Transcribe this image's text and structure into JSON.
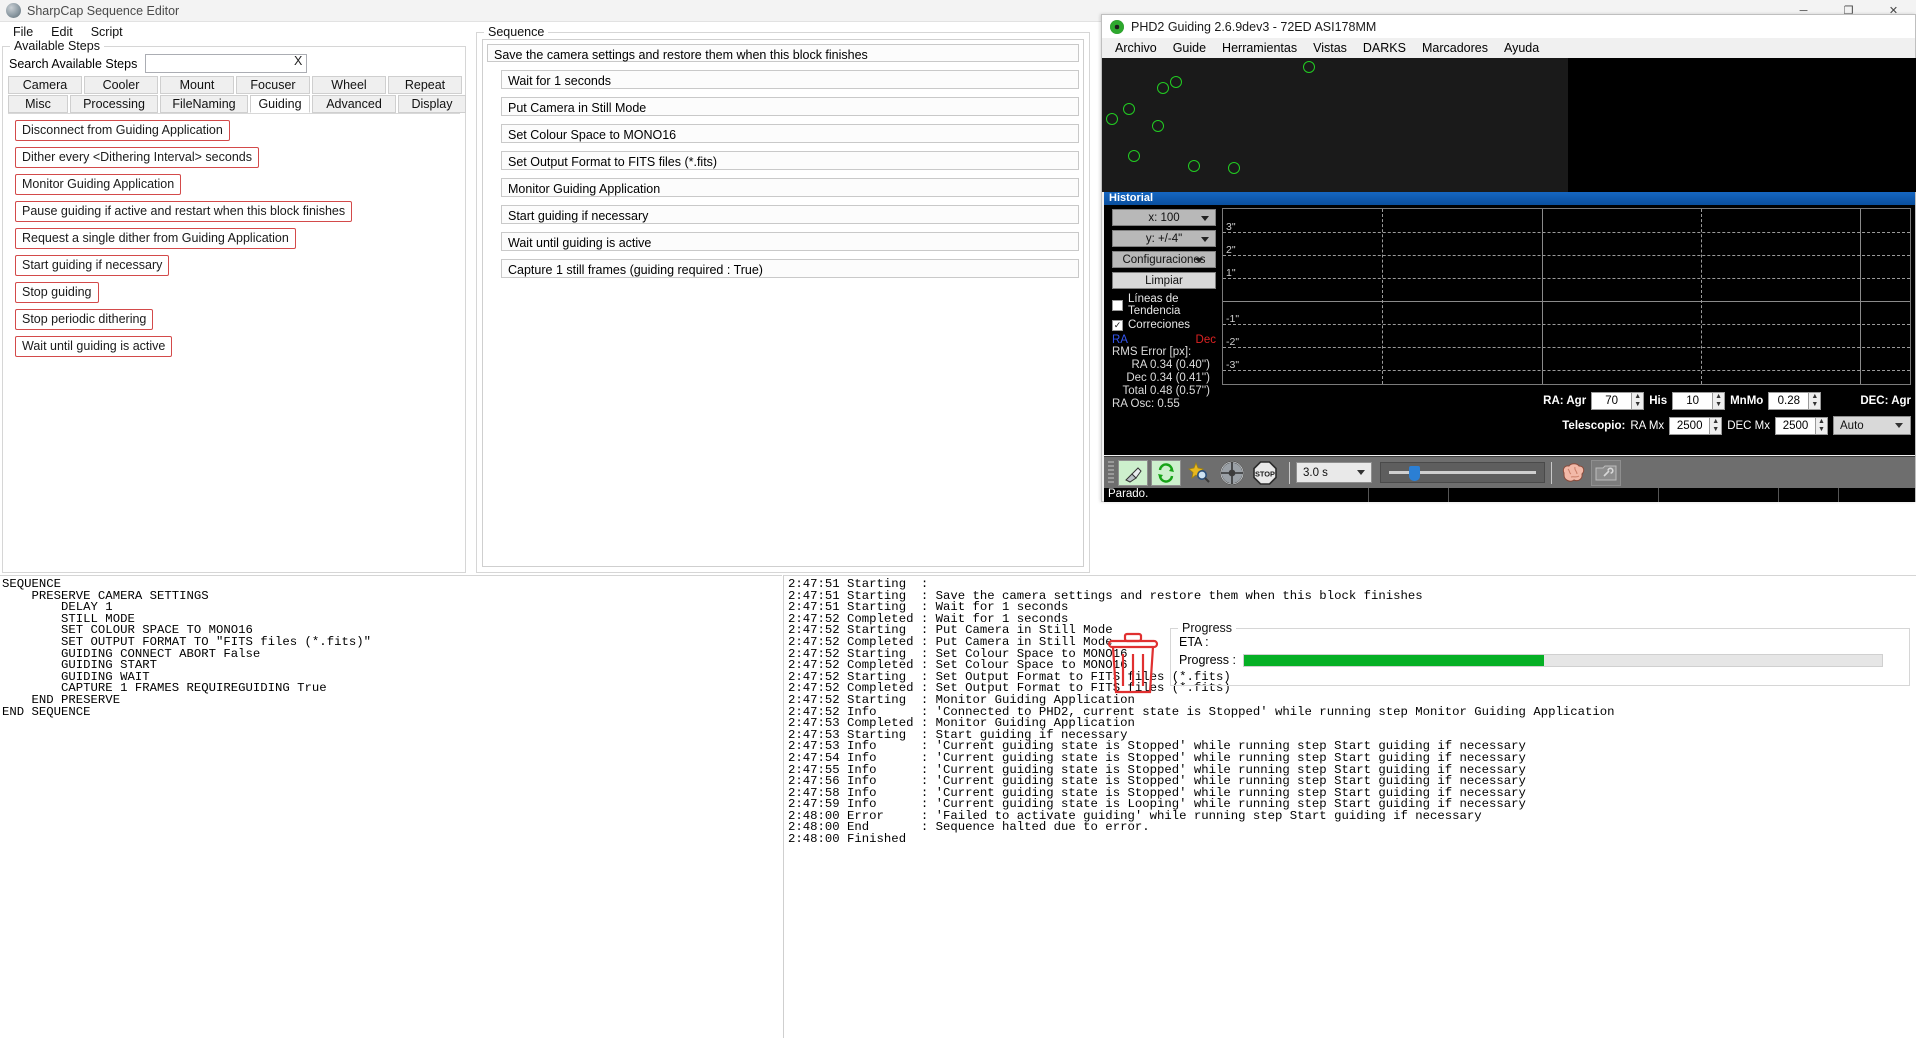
{
  "sharpcap": {
    "title": "SharpCap Sequence Editor",
    "window_controls": {
      "minimize": "─",
      "maximize": "❐",
      "close": "✕"
    },
    "menu": [
      "File",
      "Edit",
      "Script"
    ],
    "available_steps": {
      "group_title": "Available Steps",
      "search_label": "Search Available Steps",
      "search_value": "",
      "search_placeholder": "",
      "clear_glyph": "X",
      "tabs_row1": [
        "Camera",
        "Cooler",
        "Mount",
        "Focuser",
        "Wheel",
        "Repeat"
      ],
      "tabs_row2": [
        "Misc",
        "Processing",
        "FileNaming",
        "Guiding",
        "Advanced",
        "Display"
      ],
      "selected_tab": "Guiding",
      "steps": [
        "Disconnect from Guiding Application",
        "Dither every <Dithering Interval> seconds",
        "Monitor Guiding Application",
        "Pause guiding if active and restart when this block finishes",
        "Request a single dither from Guiding Application",
        "Start guiding if necessary",
        "Stop guiding",
        "Stop periodic dithering",
        "Wait until guiding is active"
      ]
    },
    "sequence": {
      "group_title": "Sequence",
      "root": "Save the camera settings and restore them when this block finishes",
      "children": [
        "Wait for 1 seconds",
        "Put Camera in Still Mode",
        "Set Colour Space to MONO16",
        "Set Output Format to FITS files (*.fits)",
        "Monitor Guiding Application",
        "Start guiding if necessary",
        "Wait until guiding is active",
        "Capture 1 still frames (guiding required : True)"
      ]
    },
    "script_text": "SEQUENCE\n    PRESERVE CAMERA SETTINGS\n        DELAY 1\n        STILL MODE\n        SET COLOUR SPACE TO MONO16\n        SET OUTPUT FORMAT TO \"FITS files (*.fits)\"\n        GUIDING CONNECT ABORT False\n        GUIDING START\n        GUIDING WAIT\n        CAPTURE 1 FRAMES REQUIREGUIDING True\n    END PRESERVE\nEND SEQUENCE",
    "log_text": "2:47:51 Starting  :\n2:47:51 Starting  : Save the camera settings and restore them when this block finishes\n2:47:51 Starting  : Wait for 1 seconds\n2:47:52 Completed : Wait for 1 seconds\n2:47:52 Starting  : Put Camera in Still Mode\n2:47:52 Completed : Put Camera in Still Mode\n2:47:52 Starting  : Set Colour Space to MONO16\n2:47:52 Completed : Set Colour Space to MONO16\n2:47:52 Starting  : Set Output Format to FITS files (*.fits)\n2:47:52 Completed : Set Output Format to FITS files (*.fits)\n2:47:52 Starting  : Monitor Guiding Application\n2:47:52 Info      : 'Connected to PHD2, current state is Stopped' while running step Monitor Guiding Application\n2:47:53 Completed : Monitor Guiding Application\n2:47:53 Starting  : Start guiding if necessary\n2:47:53 Info      : 'Current guiding state is Stopped' while running step Start guiding if necessary\n2:47:54 Info      : 'Current guiding state is Stopped' while running step Start guiding if necessary\n2:47:55 Info      : 'Current guiding state is Stopped' while running step Start guiding if necessary\n2:47:56 Info      : 'Current guiding state is Stopped' while running step Start guiding if necessary\n2:47:58 Info      : 'Current guiding state is Stopped' while running step Start guiding if necessary\n2:47:59 Info      : 'Current guiding state is Looping' while running step Start guiding if necessary\n2:48:00 Error     : 'Failed to activate guiding' while running step Start guiding if necessary\n2:48:00 End       : Sequence halted due to error.\n2:48:00 Finished",
    "progress": {
      "group_title": "Progress",
      "eta_label": "ETA :",
      "progress_label": "Progress :",
      "eta_value": "",
      "percent": 47,
      "bar_color": "#06b025"
    }
  },
  "phd2": {
    "title": "PHD2 Guiding 2.6.9dev3 - 72ED ASI178MM",
    "menu": [
      "Archivo",
      "Guide",
      "Herramientas",
      "Vistas",
      "DARKS",
      "Marcadores",
      "Ayuda"
    ],
    "history": {
      "panel_title": "Historial",
      "x_scale": "x: 100",
      "y_scale": "y: +/-4\"",
      "settings_button": "Configuraciones",
      "clear_button": "Limpiar",
      "trend_lines_label": "Líneas de Tendencia",
      "trend_lines_checked": false,
      "corrections_label": "Correciones",
      "corrections_checked": true,
      "ra_legend": "RA",
      "dec_legend": "Dec",
      "rms_title": "RMS Error [px]:",
      "rms_ra": "RA  0.34 (0.40'')",
      "rms_dec": "Dec  0.34 (0.41'')",
      "rms_total": "Total  0.48 (0.57'')",
      "ra_osc": "RA Osc: 0.55",
      "y_ticks": [
        "3\"",
        "2\"",
        "1\"",
        "-1\"",
        "-2\"",
        "-3\""
      ]
    },
    "controls": {
      "ra_label": "RA: Agr",
      "ra_aggr": "70",
      "his_label": "His",
      "his_value": "10",
      "mnmo_label": "MnMo",
      "mnmo_value": "0.28",
      "dec_label": "DEC: Agr",
      "telescope_label": "Telescopio:",
      "ra_mx_label": "RA Mx",
      "ra_mx_value": "2500",
      "dec_mx_label": "DEC Mx",
      "dec_mx_value": "2500",
      "mode_value": "Auto"
    },
    "toolbar": {
      "exposure": "3.0 s",
      "icons": [
        "connect-equipment-icon",
        "loop-exposures-icon",
        "auto-select-star-icon",
        "guide-icon",
        "stop-icon",
        "brain-settings-icon",
        "advanced-settings-icon"
      ]
    },
    "status": "Parado."
  }
}
